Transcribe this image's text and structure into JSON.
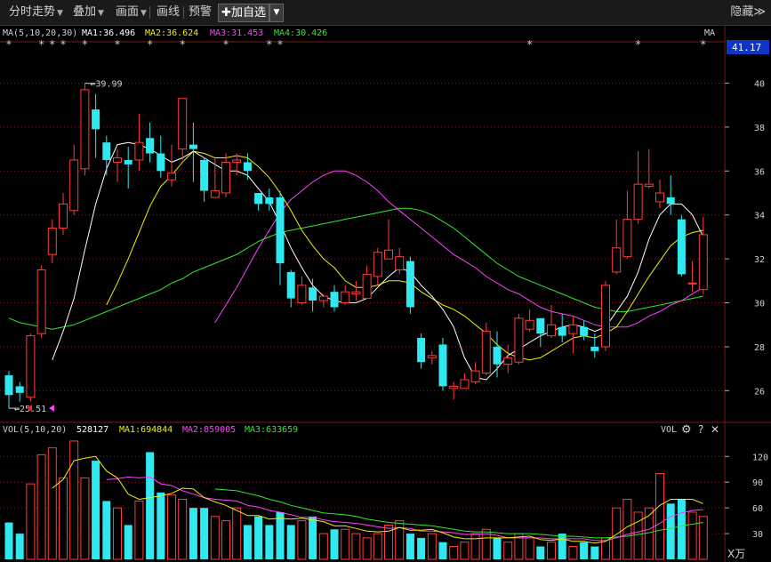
{
  "toolbar": {
    "intraday": "分时走势",
    "overlay": "叠加",
    "draw": "画面",
    "line_draw": "画线",
    "alert": "预警",
    "add_watch": "加自选",
    "hide": "隐藏"
  },
  "icons": {
    "plus": "plus-icon",
    "caret": "caret-down-icon",
    "chevrons": "double-chevron-right-icon",
    "gear": "gear-icon",
    "help": "question-icon",
    "close": "close-icon"
  },
  "colors": {
    "up": "#ff3c3c",
    "down": "#30e8f0",
    "ma1": "#ffffff",
    "ma2": "#f0f000",
    "ma3": "#ff40ff",
    "ma4": "#30e830",
    "bg": "#000000",
    "grid": "#7a1a1a",
    "price_badge": "#1034c8"
  },
  "chart_data": [
    {
      "type": "candlestick",
      "legend": {
        "params": "MA(5,10,20,30)",
        "ma1": "MA1:36.496",
        "ma2": "MA2:36.624",
        "ma3": "MA3:31.453",
        "ma4": "MA4:30.426",
        "right_label": "MA"
      },
      "current_price": "41.17",
      "ylim": [
        24.8,
        41.8
      ],
      "yticks": [
        "40",
        "38",
        "36",
        "34",
        "32",
        "30",
        "28",
        "26"
      ],
      "annotations": {
        "high": "39.99",
        "low": "25.51"
      },
      "grid": true,
      "candles": [
        [
          26.7,
          25.8,
          26.9,
          25.2
        ],
        [
          26.2,
          25.9,
          26.4,
          25.5
        ],
        [
          25.7,
          28.5,
          28.6,
          25.5
        ],
        [
          28.6,
          31.5,
          31.7,
          28.4
        ],
        [
          32.2,
          33.4,
          33.8,
          31.8
        ],
        [
          33.4,
          34.5,
          35.0,
          33.1
        ],
        [
          34.2,
          36.5,
          37.2,
          34.0
        ],
        [
          36.1,
          39.7,
          39.99,
          35.8
        ],
        [
          38.8,
          37.9,
          39.5,
          36.6
        ],
        [
          37.3,
          36.5,
          37.6,
          35.8
        ],
        [
          36.4,
          36.6,
          37.0,
          35.5
        ],
        [
          36.5,
          36.3,
          37.1,
          35.2
        ],
        [
          36.5,
          37.3,
          38.6,
          36.0
        ],
        [
          37.5,
          36.8,
          38.2,
          36.4
        ],
        [
          36.8,
          36.0,
          37.6,
          35.7
        ],
        [
          35.6,
          35.9,
          37.2,
          35.3
        ],
        [
          37.0,
          39.3,
          39.3,
          36.5
        ],
        [
          37.2,
          37.0,
          38.2,
          35.5
        ],
        [
          36.5,
          35.1,
          36.6,
          34.6
        ],
        [
          34.8,
          35.1,
          36.6,
          34.9
        ],
        [
          35.0,
          36.4,
          36.8,
          34.8
        ],
        [
          36.4,
          36.5,
          36.8,
          35.8
        ],
        [
          36.4,
          36.0,
          36.8,
          35.6
        ],
        [
          35.0,
          34.5,
          35.0,
          34.2
        ],
        [
          34.8,
          34.5,
          35.2,
          34.2
        ],
        [
          34.8,
          31.8,
          35.1,
          30.8
        ],
        [
          31.4,
          30.2,
          31.5,
          29.8
        ],
        [
          30.0,
          30.8,
          31.2,
          29.9
        ],
        [
          30.7,
          30.1,
          31.1,
          29.6
        ],
        [
          30.1,
          30.3,
          30.4,
          29.8
        ],
        [
          30.5,
          29.8,
          30.8,
          29.6
        ],
        [
          30.0,
          30.5,
          30.8,
          29.9
        ],
        [
          30.4,
          30.5,
          31.0,
          30.1
        ],
        [
          30.2,
          31.3,
          31.7,
          30.3
        ],
        [
          31.2,
          32.3,
          32.5,
          30.8
        ],
        [
          32.0,
          32.4,
          33.8,
          32.0
        ],
        [
          31.5,
          32.1,
          32.5,
          31.3
        ],
        [
          31.9,
          29.8,
          32.1,
          29.5
        ],
        [
          28.4,
          27.3,
          28.6,
          27.0
        ],
        [
          27.5,
          27.6,
          27.8,
          27.2
        ],
        [
          28.1,
          26.2,
          28.4,
          26.0
        ],
        [
          26.1,
          26.2,
          26.4,
          25.6
        ],
        [
          26.1,
          26.5,
          26.8,
          26.2
        ],
        [
          26.4,
          26.9,
          27.3,
          26.3
        ],
        [
          26.8,
          28.7,
          29.1,
          26.7
        ],
        [
          28.0,
          27.2,
          28.7,
          26.6
        ],
        [
          27.2,
          27.5,
          28.1,
          26.8
        ],
        [
          27.3,
          29.3,
          29.5,
          27.2
        ],
        [
          28.8,
          29.2,
          29.7,
          28.7
        ],
        [
          29.3,
          28.6,
          29.3,
          28.0
        ],
        [
          28.5,
          29.0,
          29.9,
          28.4
        ],
        [
          28.9,
          28.5,
          29.5,
          28.2
        ],
        [
          28.6,
          29.0,
          29.4,
          27.7
        ],
        [
          28.9,
          28.5,
          29.2,
          28.3
        ],
        [
          28.0,
          27.8,
          28.6,
          27.5
        ],
        [
          28.0,
          30.8,
          31.0,
          27.8
        ],
        [
          31.4,
          32.5,
          33.8,
          31.3
        ],
        [
          32.1,
          33.8,
          35.1,
          32.0
        ],
        [
          33.8,
          35.4,
          36.9,
          33.6
        ],
        [
          35.3,
          35.4,
          37.0,
          35.2
        ],
        [
          34.6,
          35.0,
          35.6,
          34.3
        ],
        [
          34.8,
          34.5,
          35.8,
          34.0
        ],
        [
          33.8,
          31.3,
          34.0,
          31.2
        ],
        [
          30.9,
          30.9,
          31.9,
          30.5
        ],
        [
          30.6,
          33.1,
          33.9,
          30.4
        ]
      ],
      "ma": {
        "ma1": [
          null,
          null,
          null,
          null,
          27.4,
          28.7,
          30.2,
          32.4,
          34.5,
          36.1,
          37.2,
          37.3,
          37.2,
          37.0,
          36.7,
          36.4,
          36.6,
          36.9,
          36.6,
          36.3,
          36.0,
          36.0,
          35.8,
          35.2,
          34.6,
          33.6,
          32.5,
          31.6,
          30.8,
          30.3,
          30.1,
          30.0,
          30.0,
          30.2,
          30.7,
          31.2,
          31.6,
          31.4,
          30.8,
          30.3,
          29.7,
          28.9,
          27.5,
          26.6,
          26.5,
          27.0,
          27.6,
          27.9,
          28.2,
          28.5,
          28.7,
          28.9,
          29.0,
          28.9,
          28.7,
          28.9,
          29.6,
          30.3,
          31.4,
          32.9,
          34.0,
          34.5,
          34.5,
          34.0,
          33.0
        ],
        "ma2": [
          null,
          null,
          null,
          null,
          null,
          null,
          null,
          null,
          null,
          29.9,
          30.9,
          32.0,
          33.2,
          34.4,
          35.3,
          35.8,
          36.4,
          36.9,
          36.8,
          36.6,
          36.6,
          36.7,
          36.6,
          36.2,
          35.7,
          35.0,
          34.2,
          33.3,
          32.6,
          32.0,
          31.6,
          31.0,
          30.7,
          30.7,
          30.8,
          31.0,
          31.0,
          30.9,
          30.5,
          30.2,
          29.9,
          29.7,
          29.4,
          29.0,
          28.6,
          28.1,
          27.7,
          27.5,
          27.4,
          27.5,
          27.8,
          28.1,
          28.4,
          28.5,
          28.4,
          28.6,
          28.9,
          29.6,
          30.4,
          31.2,
          31.9,
          32.6,
          33.0,
          33.2,
          33.3
        ],
        "ma3": [
          null,
          null,
          null,
          null,
          null,
          null,
          null,
          null,
          null,
          null,
          null,
          null,
          null,
          null,
          null,
          null,
          null,
          null,
          null,
          29.1,
          29.9,
          30.7,
          31.6,
          32.5,
          33.3,
          34.1,
          34.7,
          35.1,
          35.5,
          35.8,
          36.0,
          36.0,
          35.8,
          35.5,
          35.1,
          34.6,
          34.2,
          33.8,
          33.4,
          33.0,
          32.6,
          32.2,
          31.9,
          31.6,
          31.2,
          30.9,
          30.6,
          30.4,
          30.1,
          29.8,
          29.6,
          29.5,
          29.4,
          29.2,
          29.0,
          28.9,
          28.9,
          28.9,
          29.1,
          29.4,
          29.6,
          29.9,
          30.1,
          30.4,
          30.7
        ],
        "ma4": [
          29.3,
          29.1,
          29.0,
          28.9,
          28.8,
          28.9,
          29.0,
          29.2,
          29.4,
          29.6,
          29.8,
          30.0,
          30.2,
          30.4,
          30.6,
          30.9,
          31.1,
          31.4,
          31.6,
          31.8,
          32.0,
          32.2,
          32.5,
          32.8,
          33.0,
          33.2,
          33.3,
          33.4,
          33.5,
          33.6,
          33.7,
          33.8,
          33.9,
          34.0,
          34.1,
          34.2,
          34.3,
          34.3,
          34.2,
          34.0,
          33.7,
          33.4,
          33.0,
          32.6,
          32.2,
          31.8,
          31.5,
          31.2,
          31.0,
          30.8,
          30.6,
          30.4,
          30.2,
          30.0,
          29.8,
          29.7,
          29.6,
          29.6,
          29.7,
          29.8,
          29.9,
          30.0,
          30.1,
          30.2,
          30.3
        ]
      }
    },
    {
      "type": "bar",
      "legend": {
        "params": "VOL(5,10,20)",
        "value": "528127",
        "ma1": "MA1:694844",
        "ma2": "MA2:859005",
        "ma3": "MA3:633659",
        "right_label": "VOL"
      },
      "unit": "X万",
      "ylim": [
        0,
        140
      ],
      "yticks": [
        "120",
        "90",
        "60",
        "30"
      ],
      "volumes": [
        43,
        30,
        88,
        122,
        130,
        95,
        138,
        95,
        115,
        68,
        60,
        40,
        68,
        125,
        78,
        75,
        70,
        60,
        60,
        50,
        45,
        60,
        40,
        50,
        40,
        55,
        40,
        45,
        50,
        30,
        35,
        35,
        30,
        25,
        30,
        40,
        45,
        30,
        25,
        30,
        20,
        15,
        20,
        30,
        35,
        25,
        20,
        30,
        25,
        15,
        20,
        30,
        15,
        20,
        15,
        25,
        60,
        70,
        55,
        60,
        100,
        65,
        70,
        55,
        50,
        80
      ],
      "ma": {
        "ma1": [
          null,
          null,
          null,
          null,
          83,
          93,
          115,
          118,
          120,
          103,
          95,
          76,
          70,
          72,
          74,
          77,
          83,
          82,
          72,
          67,
          63,
          57,
          51,
          51,
          47,
          48,
          47,
          48,
          46,
          44,
          39,
          39,
          36,
          33,
          32,
          33,
          37,
          34,
          34,
          35,
          31,
          26,
          24,
          24,
          25,
          25,
          25,
          26,
          27,
          23,
          22,
          24,
          21,
          21,
          19,
          21,
          29,
          38,
          44,
          51,
          63,
          70,
          70,
          70,
          65,
          67
        ],
        "ma2": [
          null,
          null,
          null,
          null,
          null,
          null,
          null,
          null,
          null,
          93,
          94,
          96,
          95,
          96,
          88,
          86,
          80,
          76,
          72,
          70,
          69,
          68,
          63,
          61,
          57,
          55,
          52,
          49,
          49,
          46,
          44,
          43,
          42,
          40,
          38,
          36,
          37,
          36,
          33,
          33,
          32,
          31,
          29,
          29,
          30,
          28,
          25,
          25,
          25,
          25,
          24,
          24,
          24,
          24,
          22,
          22,
          25,
          29,
          32,
          35,
          42,
          50,
          54,
          57,
          58,
          61
        ],
        "ma3": [
          null,
          null,
          null,
          null,
          null,
          null,
          null,
          null,
          null,
          null,
          null,
          null,
          null,
          null,
          null,
          null,
          null,
          null,
          null,
          82,
          81,
          80,
          77,
          74,
          70,
          67,
          63,
          60,
          57,
          54,
          53,
          52,
          50,
          47,
          45,
          43,
          42,
          41,
          40,
          39,
          37,
          35,
          33,
          32,
          32,
          31,
          30,
          30,
          30,
          29,
          28,
          27,
          27,
          26,
          25,
          25,
          26,
          27,
          29,
          31,
          34,
          36,
          39,
          41,
          43,
          46
        ]
      }
    }
  ]
}
